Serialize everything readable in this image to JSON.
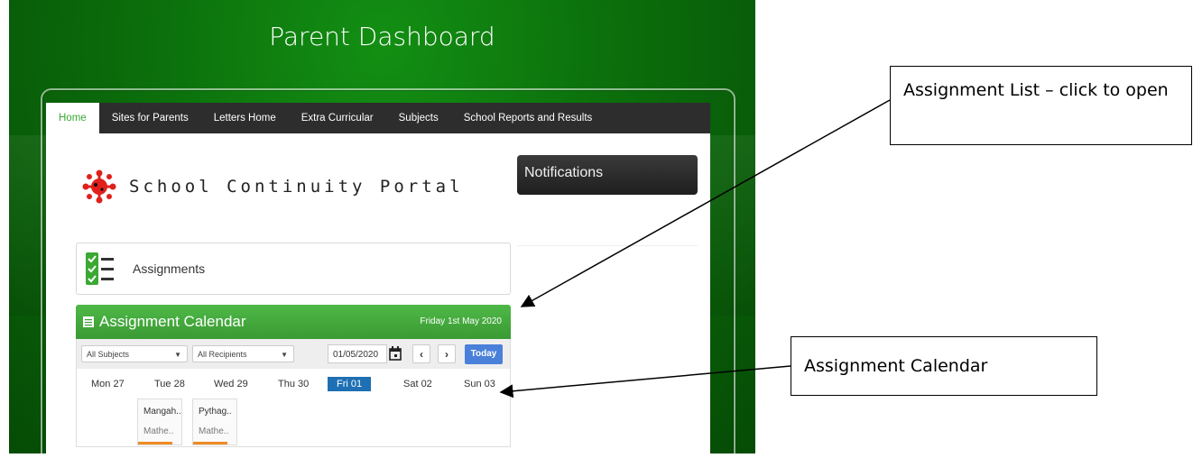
{
  "header": {
    "title": "Parent Dashboard"
  },
  "nav": {
    "items": [
      {
        "label": "Home",
        "active": true
      },
      {
        "label": "Sites for Parents"
      },
      {
        "label": "Letters Home"
      },
      {
        "label": "Extra Curricular"
      },
      {
        "label": "Subjects"
      },
      {
        "label": "School Reports and Results"
      }
    ]
  },
  "portal": {
    "title": "School Continuity Portal"
  },
  "notifications": {
    "label": "Notifications"
  },
  "assignments": {
    "label": "Assignments"
  },
  "calendar": {
    "title": "Assignment Calendar",
    "date": "Friday 1st May 2020",
    "filters": {
      "subjects": "All Subjects",
      "recipients": "All Recipients"
    },
    "date_value": "01/05/2020",
    "prev": "‹",
    "next": "›",
    "today": "Today",
    "days": [
      "Mon 27",
      "Tue 28",
      "Wed 29",
      "Thu 30",
      "Fri 01",
      "Sat 02",
      "Sun 03"
    ],
    "active_day": "Fri 01",
    "events": [
      {
        "title": "Mangah..",
        "subject": "Mathe.."
      },
      {
        "title": "Pythag..",
        "subject": "Mathe.."
      }
    ]
  },
  "annotations": {
    "assignment_list": "Assignment List – click to open",
    "assignment_calendar": "Assignment Calendar"
  },
  "colors": {
    "brand_green": "#3ba832",
    "active_day_blue": "#1e6fb3",
    "today_button": "#4a80d9",
    "event_bar": "#f08a24"
  }
}
